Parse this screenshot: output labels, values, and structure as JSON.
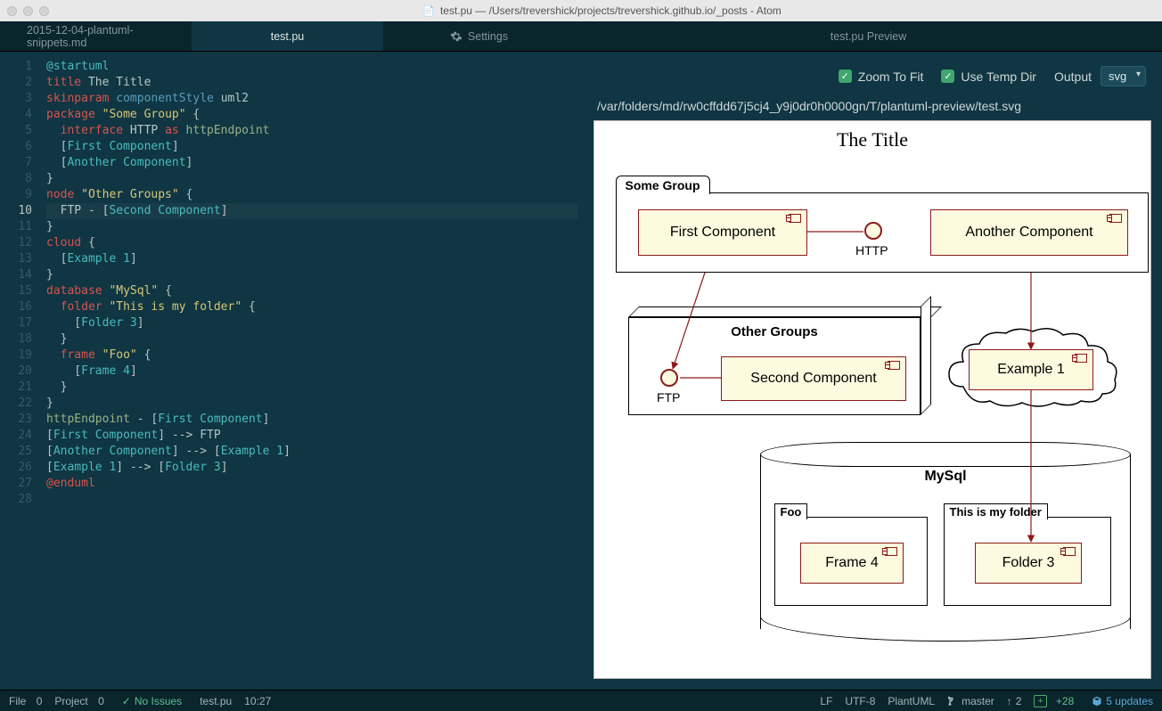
{
  "window": {
    "title": "test.pu — /Users/trevershick/projects/trevershick.github.io/_posts - Atom"
  },
  "tabs": [
    {
      "label": "2015-12-04-plantuml-snippets.md",
      "active": false
    },
    {
      "label": "test.pu",
      "active": true
    },
    {
      "label": "Settings",
      "active": false,
      "icon": "gear"
    },
    {
      "label": "test.pu Preview",
      "active": false
    }
  ],
  "editor": {
    "current_line": 10,
    "lines": [
      [
        {
          "t": "@startuml",
          "c": "tok-cy"
        }
      ],
      [
        {
          "t": "title ",
          "c": "tok-red"
        },
        {
          "t": "The Title",
          "c": ""
        }
      ],
      [
        {
          "t": "skinparam ",
          "c": "tok-red"
        },
        {
          "t": "componentStyle ",
          "c": "tok-bl"
        },
        {
          "t": "uml2",
          "c": ""
        }
      ],
      [
        {
          "t": "package ",
          "c": "tok-red"
        },
        {
          "t": "\"Some Group\"",
          "c": "tok-yl"
        },
        {
          "t": " {",
          "c": ""
        }
      ],
      [
        {
          "t": "  interface ",
          "c": "tok-red"
        },
        {
          "t": "HTTP ",
          "c": ""
        },
        {
          "t": "as ",
          "c": "tok-red"
        },
        {
          "t": "httpEndpoint",
          "c": "tok-gr"
        }
      ],
      [
        {
          "t": "  [",
          "c": ""
        },
        {
          "t": "First Component",
          "c": "tok-cy"
        },
        {
          "t": "]",
          "c": ""
        }
      ],
      [
        {
          "t": "  [",
          "c": ""
        },
        {
          "t": "Another Component",
          "c": "tok-cy"
        },
        {
          "t": "]",
          "c": ""
        }
      ],
      [
        {
          "t": "}",
          "c": ""
        }
      ],
      [
        {
          "t": "node ",
          "c": "tok-red"
        },
        {
          "t": "\"Other Groups\"",
          "c": "tok-yl"
        },
        {
          "t": " {",
          "c": ""
        }
      ],
      [
        {
          "t": "  FTP - [",
          "c": ""
        },
        {
          "t": "Second Component",
          "c": "tok-cy"
        },
        {
          "t": "]",
          "c": ""
        }
      ],
      [
        {
          "t": "}",
          "c": ""
        }
      ],
      [
        {
          "t": "cloud ",
          "c": "tok-red"
        },
        {
          "t": "{",
          "c": ""
        }
      ],
      [
        {
          "t": "  [",
          "c": ""
        },
        {
          "t": "Example 1",
          "c": "tok-cy"
        },
        {
          "t": "]",
          "c": ""
        }
      ],
      [
        {
          "t": "}",
          "c": ""
        }
      ],
      [
        {
          "t": "database ",
          "c": "tok-red"
        },
        {
          "t": "\"MySql\"",
          "c": "tok-yl"
        },
        {
          "t": " {",
          "c": ""
        }
      ],
      [
        {
          "t": "  folder ",
          "c": "tok-red"
        },
        {
          "t": "\"This is my folder\"",
          "c": "tok-yl"
        },
        {
          "t": " {",
          "c": ""
        }
      ],
      [
        {
          "t": "    [",
          "c": ""
        },
        {
          "t": "Folder 3",
          "c": "tok-cy"
        },
        {
          "t": "]",
          "c": ""
        }
      ],
      [
        {
          "t": "  }",
          "c": ""
        }
      ],
      [
        {
          "t": "  frame ",
          "c": "tok-red"
        },
        {
          "t": "\"Foo\"",
          "c": "tok-yl"
        },
        {
          "t": " {",
          "c": ""
        }
      ],
      [
        {
          "t": "    [",
          "c": ""
        },
        {
          "t": "Frame 4",
          "c": "tok-cy"
        },
        {
          "t": "]",
          "c": ""
        }
      ],
      [
        {
          "t": "  }",
          "c": ""
        }
      ],
      [
        {
          "t": "}",
          "c": ""
        }
      ],
      [
        {
          "t": "httpEndpoint",
          "c": "tok-gr"
        },
        {
          "t": " - [",
          "c": ""
        },
        {
          "t": "First Component",
          "c": "tok-cy"
        },
        {
          "t": "]",
          "c": ""
        }
      ],
      [
        {
          "t": "[",
          "c": ""
        },
        {
          "t": "First Component",
          "c": "tok-cy"
        },
        {
          "t": "] --> FTP",
          "c": ""
        }
      ],
      [
        {
          "t": "[",
          "c": ""
        },
        {
          "t": "Another Component",
          "c": "tok-cy"
        },
        {
          "t": "] --> [",
          "c": ""
        },
        {
          "t": "Example 1",
          "c": "tok-cy"
        },
        {
          "t": "]",
          "c": ""
        }
      ],
      [
        {
          "t": "[",
          "c": ""
        },
        {
          "t": "Example 1",
          "c": "tok-cy"
        },
        {
          "t": "] --> [",
          "c": ""
        },
        {
          "t": "Folder 3",
          "c": "tok-cy"
        },
        {
          "t": "]",
          "c": ""
        }
      ],
      [
        {
          "t": "@enduml",
          "c": "tok-red"
        }
      ],
      [
        {
          "t": "",
          "c": ""
        }
      ]
    ]
  },
  "preview": {
    "zoom_label": "Zoom To Fit",
    "temp_label": "Use Temp Dir",
    "output_label": "Output",
    "output_value": "svg",
    "path": "/var/folders/md/rw0cffdd67j5cj4_y9j0dr0h0000gn/T/plantuml-preview/test.svg"
  },
  "diagram": {
    "title": "The Title",
    "package_label": "Some Group",
    "comp_first": "First Component",
    "comp_another": "Another Component",
    "iface_http": "HTTP",
    "node_label": "Other Groups",
    "iface_ftp": "FTP",
    "comp_second": "Second Component",
    "cloud_comp": "Example 1",
    "db_label": "MySql",
    "frame_label": "Foo",
    "comp_frame": "Frame 4",
    "folder_label": "This is my folder",
    "comp_folder": "Folder 3"
  },
  "status": {
    "file_label": "File",
    "file_count": "0",
    "project_label": "Project",
    "project_count": "0",
    "issues": "No Issues",
    "filename": "test.pu",
    "cursor": "10:27",
    "line_ending": "LF",
    "encoding": "UTF-8",
    "grammar": "PlantUML",
    "branch": "master",
    "ahead": "2",
    "stash": "+28",
    "updates": "5 updates"
  }
}
